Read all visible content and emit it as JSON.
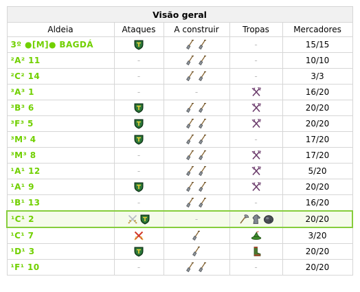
{
  "title": "Visão geral",
  "headers": {
    "village": "Aldeia",
    "attacks": "Ataques",
    "building": "A construir",
    "troops": "Tropas",
    "merchants": "Mercadores"
  },
  "dash": "-",
  "rows": [
    {
      "village": "3º ●[M]● BAGDÁ",
      "attacks": [
        "shield-icon"
      ],
      "building": [
        "shovel-icon",
        "shovel-icon"
      ],
      "troops": [],
      "merchants": "15/15"
    },
    {
      "village": "²A² 11",
      "attacks": [],
      "building": [
        "shovel-icon",
        "shovel-icon"
      ],
      "troops": [],
      "merchants": "10/10"
    },
    {
      "village": "²C² 14",
      "attacks": [],
      "building": [
        "shovel-icon",
        "shovel-icon"
      ],
      "troops": [],
      "merchants": "3/3"
    },
    {
      "village": "³A³ 1",
      "attacks": [],
      "building": [],
      "troops": [
        "crossed-weapons-icon"
      ],
      "merchants": "16/20"
    },
    {
      "village": "³B³ 6",
      "attacks": [
        "shield-icon"
      ],
      "building": [
        "shovel-icon",
        "shovel-icon"
      ],
      "troops": [
        "crossed-weapons-icon"
      ],
      "merchants": "20/20"
    },
    {
      "village": "³F³ 5",
      "attacks": [
        "shield-icon"
      ],
      "building": [
        "shovel-icon",
        "shovel-icon"
      ],
      "troops": [
        "crossed-weapons-icon"
      ],
      "merchants": "20/20"
    },
    {
      "village": "³M³ 4",
      "attacks": [
        "shield-icon"
      ],
      "building": [
        "shovel-icon",
        "shovel-icon"
      ],
      "troops": [],
      "merchants": "17/20"
    },
    {
      "village": "³M³ 8",
      "attacks": [],
      "building": [
        "shovel-icon",
        "shovel-icon"
      ],
      "troops": [
        "crossed-weapons-icon"
      ],
      "merchants": "17/20"
    },
    {
      "village": "¹A¹ 12",
      "attacks": [],
      "building": [
        "shovel-icon",
        "shovel-icon"
      ],
      "troops": [
        "crossed-weapons-icon"
      ],
      "merchants": "5/20"
    },
    {
      "village": "¹A¹ 9",
      "attacks": [
        "shield-icon"
      ],
      "building": [
        "shovel-icon",
        "shovel-icon"
      ],
      "troops": [
        "crossed-weapons-icon"
      ],
      "merchants": "20/20"
    },
    {
      "village": "¹B¹ 13",
      "attacks": [],
      "building": [
        "shovel-icon",
        "shovel-icon"
      ],
      "troops": [],
      "merchants": "16/20"
    },
    {
      "village": "¹C¹ 2",
      "attacks": [
        "swords-icon",
        "shield-icon"
      ],
      "building": [],
      "troops": [
        "axe-icon",
        "horse-icon",
        "catapult-icon"
      ],
      "merchants": "20/20",
      "selected": true
    },
    {
      "village": "¹C¹ 7",
      "attacks": [
        "red-swords-icon"
      ],
      "building": [
        "shovel-icon"
      ],
      "troops": [
        "hat-icon"
      ],
      "merchants": "3/20"
    },
    {
      "village": "¹D¹ 3",
      "attacks": [
        "shield-icon"
      ],
      "building": [
        "shovel-icon"
      ],
      "troops": [
        "boot-icon"
      ],
      "merchants": "20/20"
    },
    {
      "village": "¹F¹ 10",
      "attacks": [],
      "building": [
        "shovel-icon",
        "shovel-icon"
      ],
      "troops": [],
      "merchants": "20/20"
    }
  ],
  "colors": {
    "village_link": "#71d000",
    "selected_border": "#86cd3c",
    "shield_green": "#1c5a2a",
    "shield_gold": "#e8d23a"
  }
}
